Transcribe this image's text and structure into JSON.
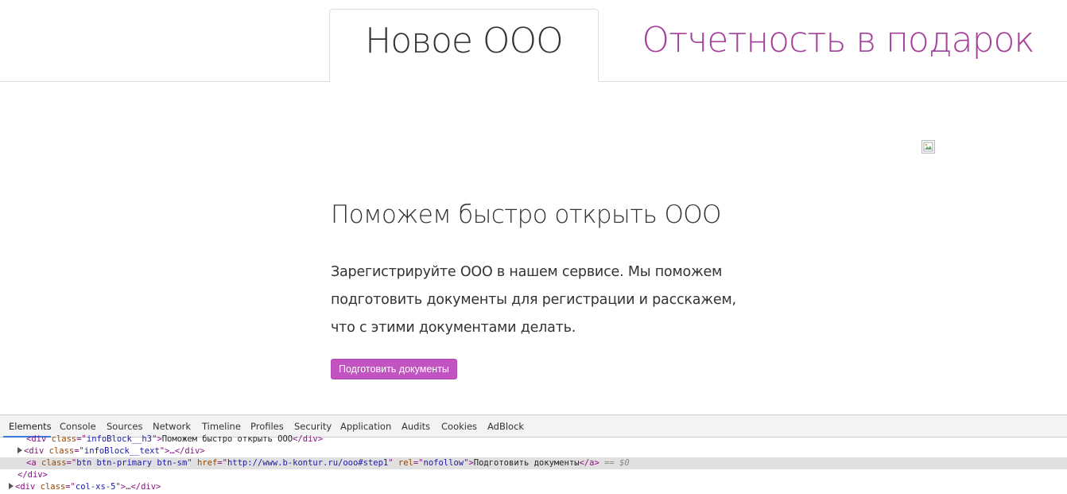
{
  "tabs": {
    "active_label": "Новое ООО",
    "link_label": "Отчетность в подарок"
  },
  "main": {
    "heading": "Поможем быстро открыть ООО",
    "body_lines": [
      "Зарегистрируйте ООО в нашем сервисе. Мы поможем",
      "подготовить документы для регистрации и расскажем,",
      "что с этими документами делать."
    ],
    "button_label": "Подготовить документы",
    "broken_image_icon": "broken-image-icon"
  },
  "colors": {
    "accent": "#a4409b",
    "button": "#c254c2",
    "devtools_selection": "#e0e0e0"
  },
  "devtools": {
    "tabs": [
      "Elements",
      "Console",
      "Sources",
      "Network",
      "Timeline",
      "Profiles",
      "Security",
      "Application",
      "Audits",
      "Cookies",
      "AdBlock"
    ],
    "active_tab": "Elements",
    "lines": {
      "l0": {
        "open": "<div",
        "attr": "class",
        "eq": "=\"",
        "val": "infoBlock__h3",
        "close": "\">",
        "text": "Поможем быстро открыть ООО",
        "end": "</div>"
      },
      "l1": {
        "open": "<div",
        "attr": "class",
        "val": "infoBlock__text",
        "mid": "\">…",
        "end": "</div>"
      },
      "l2": {
        "open": "<a",
        "attr1": "class",
        "val1": "btn btn-primary btn-sm",
        "attr2": "href",
        "val2": "http://www.b-kontur.ru/ooo#step1",
        "attr3": "rel",
        "val3": "nofollow",
        "text": "Подготовить документы",
        "end": "</a>",
        "eq0": "== $0"
      },
      "l3": {
        "end": "</div>"
      },
      "l4": {
        "open": "<div",
        "attr": "class",
        "val": "col-xs-5",
        "mid": "\">…",
        "end": "</div>"
      }
    }
  }
}
